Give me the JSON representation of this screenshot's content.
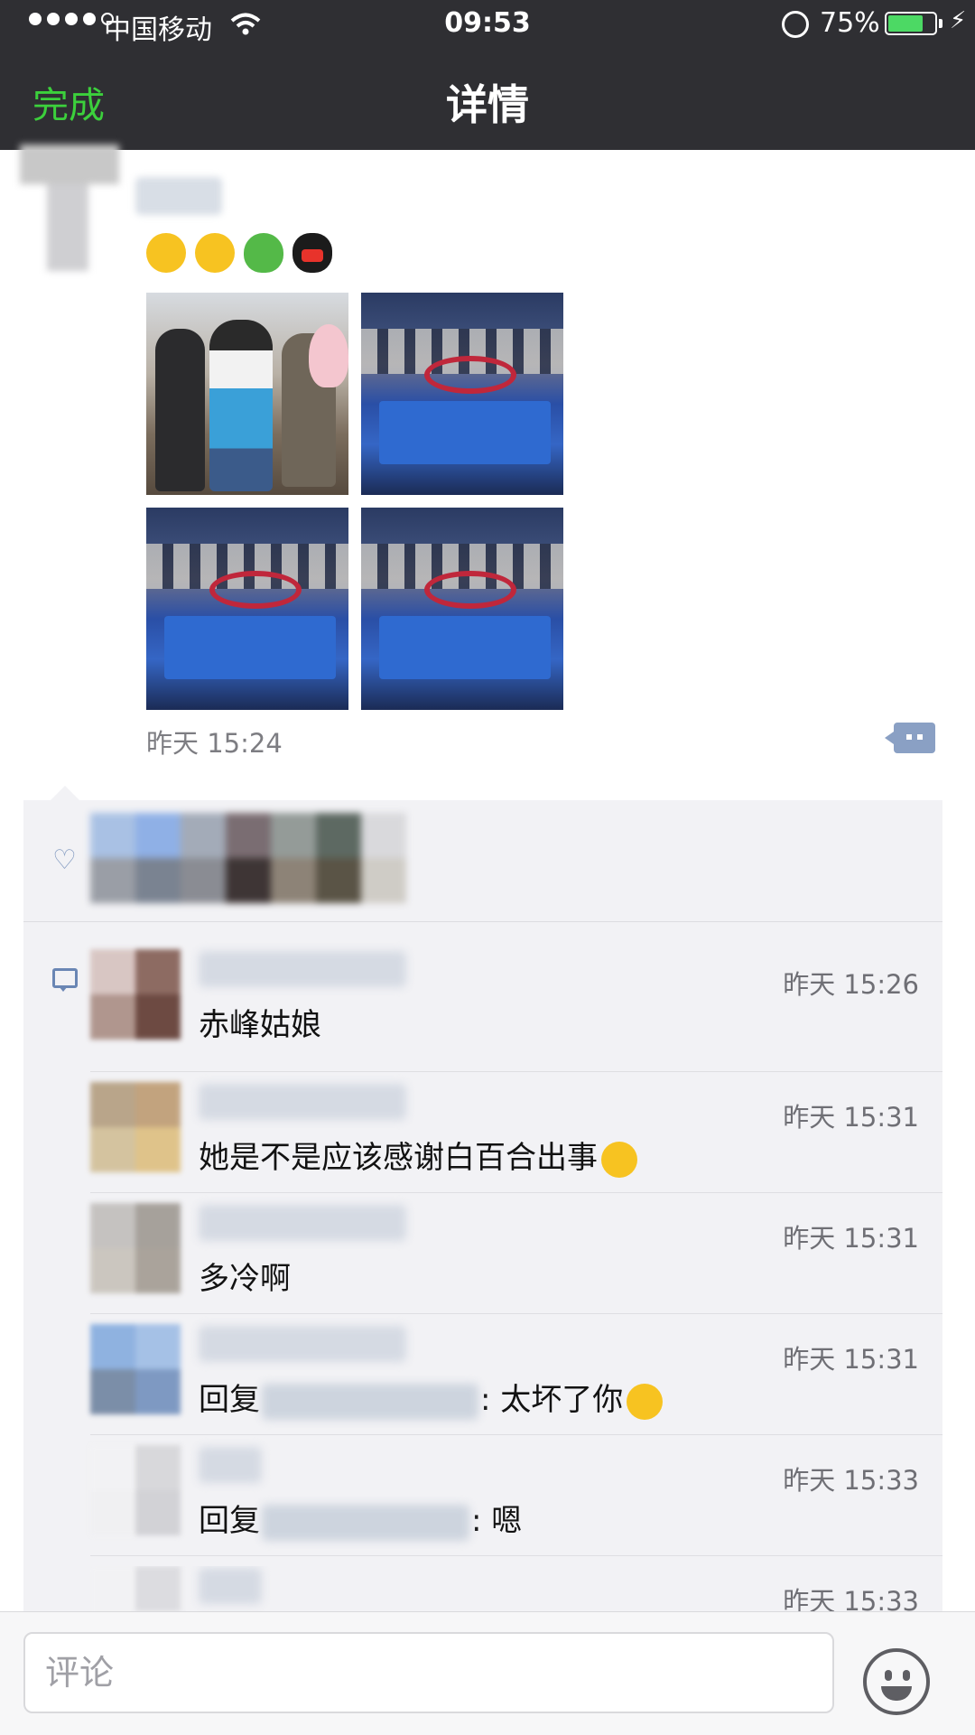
{
  "status_bar": {
    "carrier": "中国移动",
    "time": "09:53",
    "battery": "75%",
    "battery_level": 0.75,
    "signal_bars_filled": 4
  },
  "nav": {
    "done_label": "完成",
    "title": "详情"
  },
  "post": {
    "emojis": [
      "wink-emoji",
      "heart-eyes-emoji",
      "frog-emoji",
      "qq-penguin-emoji"
    ],
    "photo_count": 4,
    "time": "昨天 15:24"
  },
  "comments": [
    {
      "time": "昨天 15:26",
      "text": "赤峰姑娘",
      "avatar_colors": [
        "#d8c6c3",
        "#8d6b62",
        "#b0968e",
        "#6d4a42"
      ]
    },
    {
      "time": "昨天 15:31",
      "text": "她是不是应该感谢白百合出事",
      "emoji": "laughing-crying-emoji",
      "avatar_colors": [
        "#b9a58a",
        "#c2a37e",
        "#d4c39f",
        "#dfc38a"
      ]
    },
    {
      "time": "昨天 15:31",
      "text": "多冷啊",
      "avatar_colors": [
        "#c5c2c0",
        "#a6a19b",
        "#cbc6bf",
        "#aaa39b"
      ]
    },
    {
      "time": "昨天 15:31",
      "reply_prefix": "回复",
      "text": ": 太坏了你",
      "emoji": "smirk-emoji",
      "avatar_colors": [
        "#8fb2e0",
        "#a5c1e6",
        "#7b8ea8",
        "#7e99c2"
      ]
    },
    {
      "time": "昨天 15:33",
      "reply_prefix": "回复",
      "text": ": 嗯",
      "avatar_colors": [
        "#f2f2f4",
        "#d8d8db",
        "#f0f0f2",
        "#d2d2d6"
      ]
    },
    {
      "time": "昨天 15:33",
      "text": "",
      "avatar_colors": [
        "#f2f2f4",
        "#dcdce0",
        "#f2f2f4",
        "#f2f2f4"
      ]
    }
  ],
  "likes": {
    "avatar_colors": [
      "#a9c1e4",
      "#8fb0e6",
      "#a3abb8",
      "#7a6d72",
      "#949b98",
      "#5d6962",
      "#d9d9dc",
      "#9a9ea6",
      "#7a8391",
      "#8a8c93",
      "#3e3535",
      "#8d8377",
      "#5a5446",
      "#cfccc6"
    ]
  },
  "input": {
    "placeholder": "评论"
  },
  "colors": {
    "accent_green": "#3cd03c",
    "link_blue": "#8aa0c4",
    "nav_bg": "#2f2f33",
    "panel_bg": "#f2f2f5"
  }
}
